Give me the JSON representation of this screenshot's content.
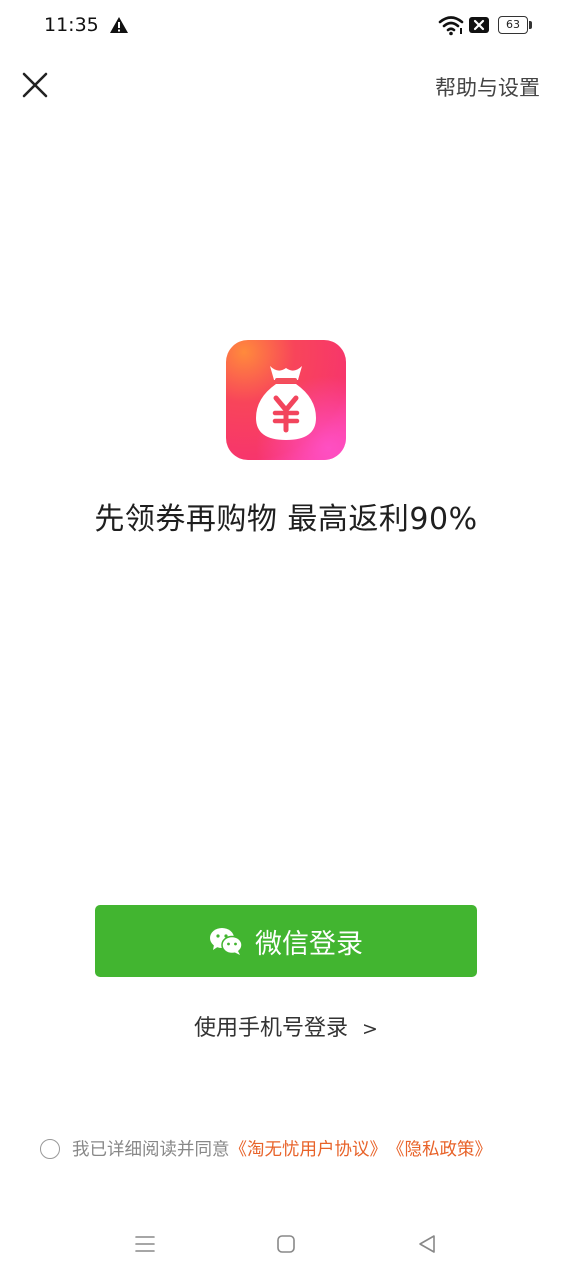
{
  "status_bar": {
    "time": "11:35",
    "battery": "63",
    "icons": [
      "warning-icon",
      "wifi-icon",
      "sim-off-icon",
      "battery-icon"
    ]
  },
  "header": {
    "help_settings": "帮助与设置",
    "close_icon": "close-icon"
  },
  "main": {
    "logo_icon": "money-bag-yuan-icon",
    "slogan": "先领券再购物 最高返利90%",
    "wechat_login": "微信登录",
    "phone_login": "使用手机号登录",
    "phone_login_arrow": ">"
  },
  "agreement": {
    "prefix": "我已详细阅读并同意",
    "user_agreement": "《淘无忧用户协议》",
    "privacy_policy": "《隐私政策》",
    "checked": false
  },
  "nav_bar": {
    "icons": [
      "menu-icon",
      "home-icon",
      "back-icon"
    ]
  },
  "colors": {
    "wechat_green": "#42b530",
    "link_orange": "#e8632a",
    "logo_red": "#f5385b",
    "logo_pink": "#ff3fa0"
  }
}
